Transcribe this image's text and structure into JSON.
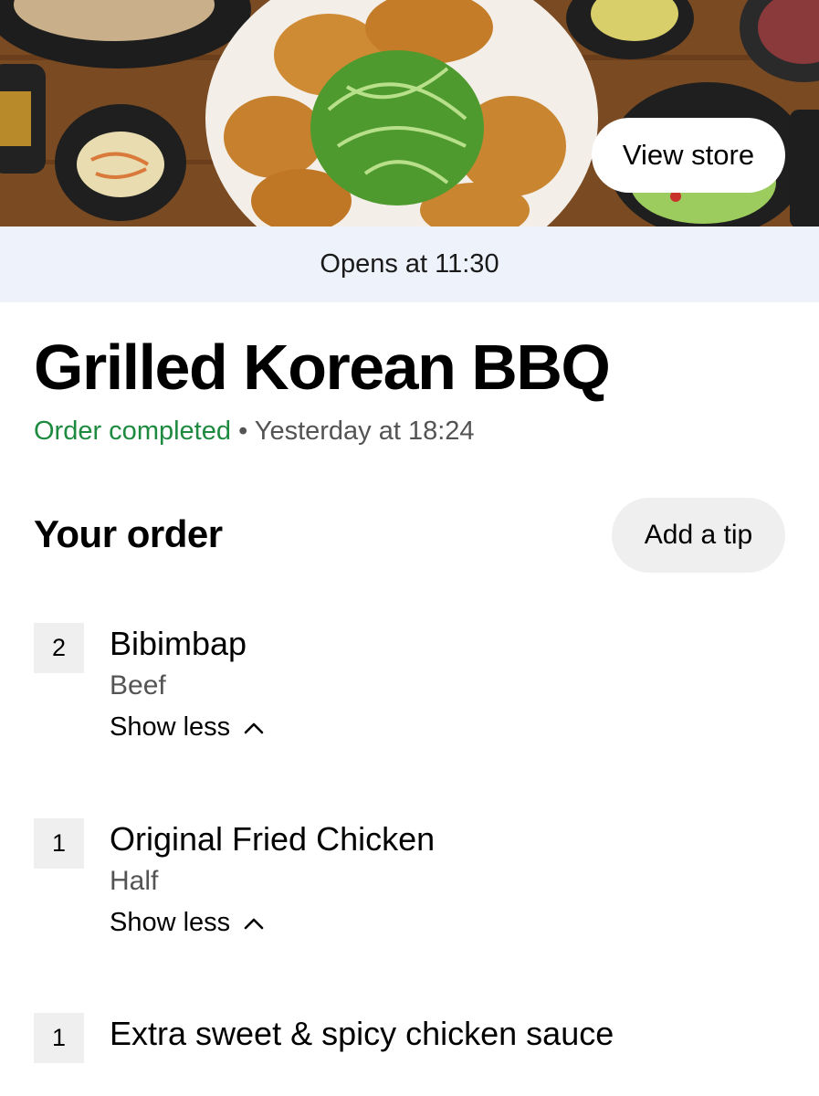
{
  "hero": {
    "view_store_label": "View store"
  },
  "banner": {
    "opens_text": "Opens at 11:30"
  },
  "store": {
    "name": "Grilled Korean BBQ",
    "status": "Order completed",
    "separator": "•",
    "time": "Yesterday at 18:24"
  },
  "order": {
    "heading": "Your order",
    "add_tip_label": "Add a tip",
    "items": [
      {
        "qty": "2",
        "name": "Bibimbap",
        "option": "Beef",
        "toggle_label": "Show less"
      },
      {
        "qty": "1",
        "name": "Original Fried Chicken",
        "option": "Half",
        "toggle_label": "Show less"
      },
      {
        "qty": "1",
        "name": "Extra sweet & spicy chicken sauce"
      }
    ]
  },
  "colors": {
    "status_green": "#1e8a3f",
    "banner_bg": "#eef2fb",
    "chip_bg": "#efefef"
  },
  "icons": {
    "toggle": "chevron-up-icon"
  }
}
